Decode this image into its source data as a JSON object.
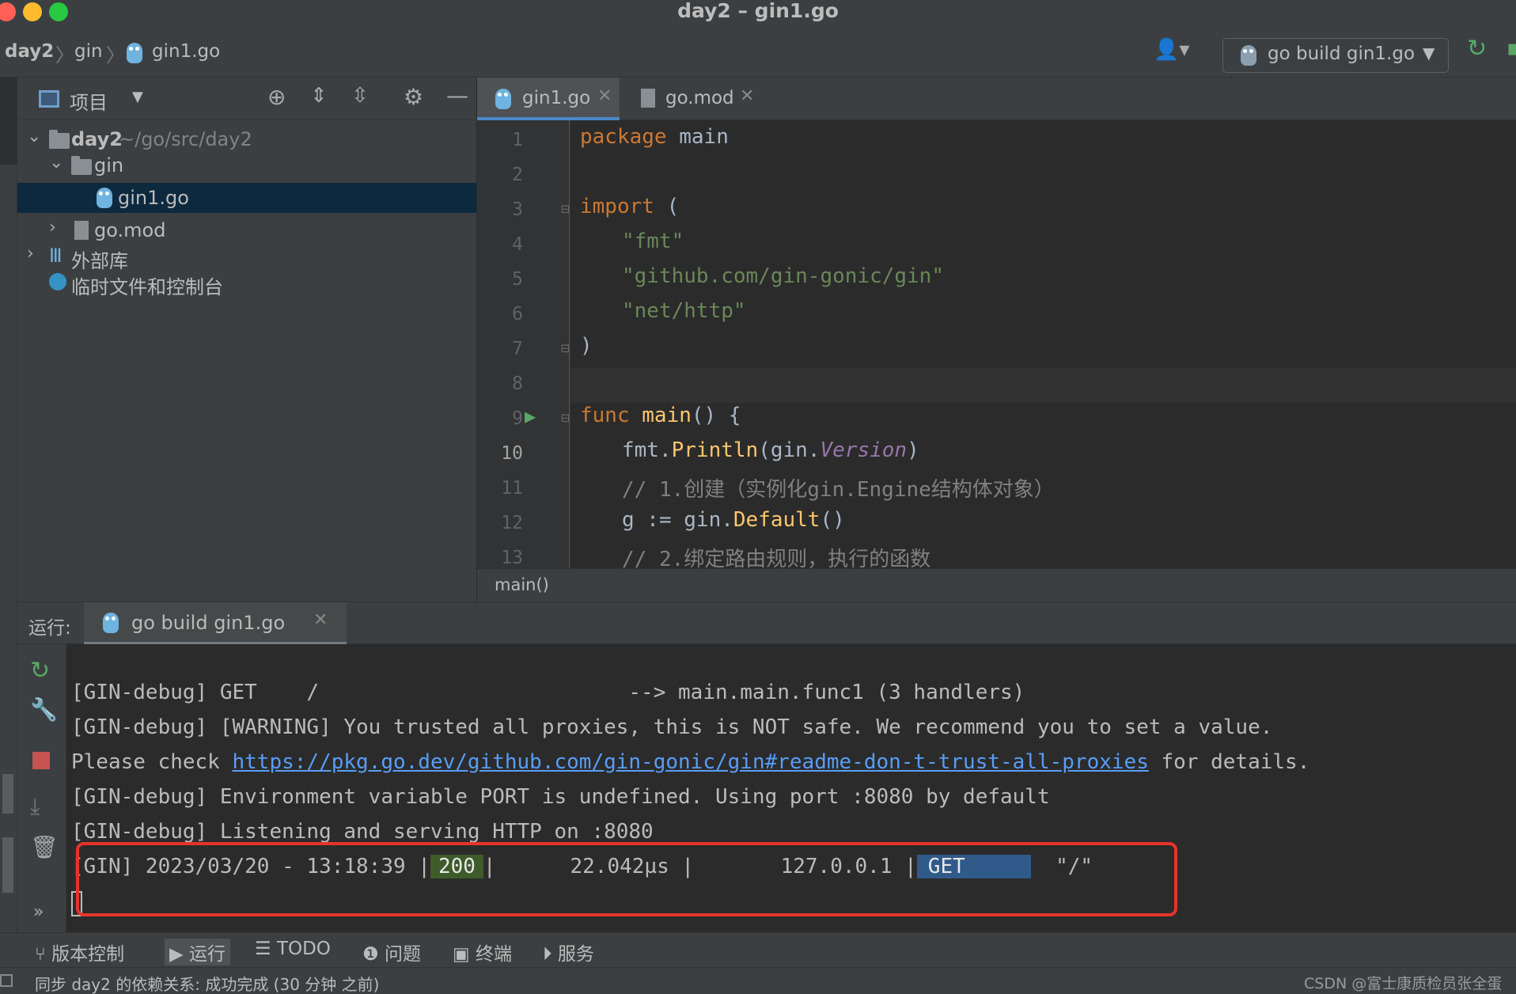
{
  "window": {
    "title": "day2 – gin1.go"
  },
  "navbar": {
    "crumbs": [
      "day2",
      "gin",
      "gin1.go"
    ],
    "run_config": "go build gin1.go"
  },
  "project": {
    "title": "项目",
    "tree": [
      {
        "label": "day2",
        "hint": "~/go/src/day2"
      },
      {
        "label": "gin"
      },
      {
        "label": "gin1.go"
      },
      {
        "label": "go.mod"
      },
      {
        "label": "外部库"
      },
      {
        "label": "临时文件和控制台"
      }
    ]
  },
  "editor": {
    "tabs": [
      {
        "label": "gin1.go"
      },
      {
        "label": "go.mod"
      }
    ],
    "line_numbers": [
      "1",
      "2",
      "3",
      "4",
      "5",
      "6",
      "7",
      "8",
      "9",
      "10",
      "11",
      "12",
      "13"
    ],
    "lines": {
      "l1_kw": "package",
      "l1_rest": " main",
      "l3_kw": "import",
      "l3_rest": " (",
      "l4": "\"fmt\"",
      "l5": "\"github.com/gin-gonic/gin\"",
      "l6": "\"net/http\"",
      "l7": ")",
      "l9_kw": "func",
      "l9_fn": "main",
      "l9_rest": "() {",
      "l10_a": "fmt.",
      "l10_fn": "Println",
      "l10_b": "(gin.",
      "l10_it": "Version",
      "l10_c": ")",
      "l11": "// 1.创建（实例化gin.Engine结构体对象）",
      "l12_a": "g := gin.",
      "l12_fn": "Default",
      "l12_b": "()",
      "l13": "// 2.绑定路由规则，执行的函数"
    },
    "breadcrumb": "main()"
  },
  "run": {
    "label": "运行:",
    "tab": "go build gin1.go",
    "console": {
      "line1": "[GIN-debug] GET    /                         --> main.main.func1 (3 handlers)",
      "line2": "[GIN-debug] [WARNING] You trusted all proxies, this is NOT safe. We recommend you to set a value.",
      "line3_pre": "Please check ",
      "line3_link": "https://pkg.go.dev/github.com/gin-gonic/gin#readme-don-t-trust-all-proxies",
      "line3_post": " for details.",
      "line4": "[GIN-debug] Environment variable PORT is undefined. Using port :8080 by default",
      "line5": "[GIN-debug] Listening and serving HTTP on :8080",
      "log_prefix": "[GIN] 2023/03/20 - 13:18:39 |",
      "log_status": "200",
      "log_mid": "|      22.042µs |       127.0.0.1 |",
      "log_method": "GET",
      "log_path": "\"/\""
    }
  },
  "toolbar": {
    "items": [
      "版本控制",
      "运行",
      "TODO",
      "问题",
      "终端",
      "服务"
    ]
  },
  "status": {
    "message": "同步 day2 的依赖关系: 成功完成 (30 分钟 之前)",
    "watermark": "CSDN @富士康质检员张全蛋"
  },
  "colors": {
    "status_badge": "#3e5b2a",
    "method_badge": "#2f5a8a",
    "highlight_box": "#e4342c",
    "link": "#589df6"
  }
}
